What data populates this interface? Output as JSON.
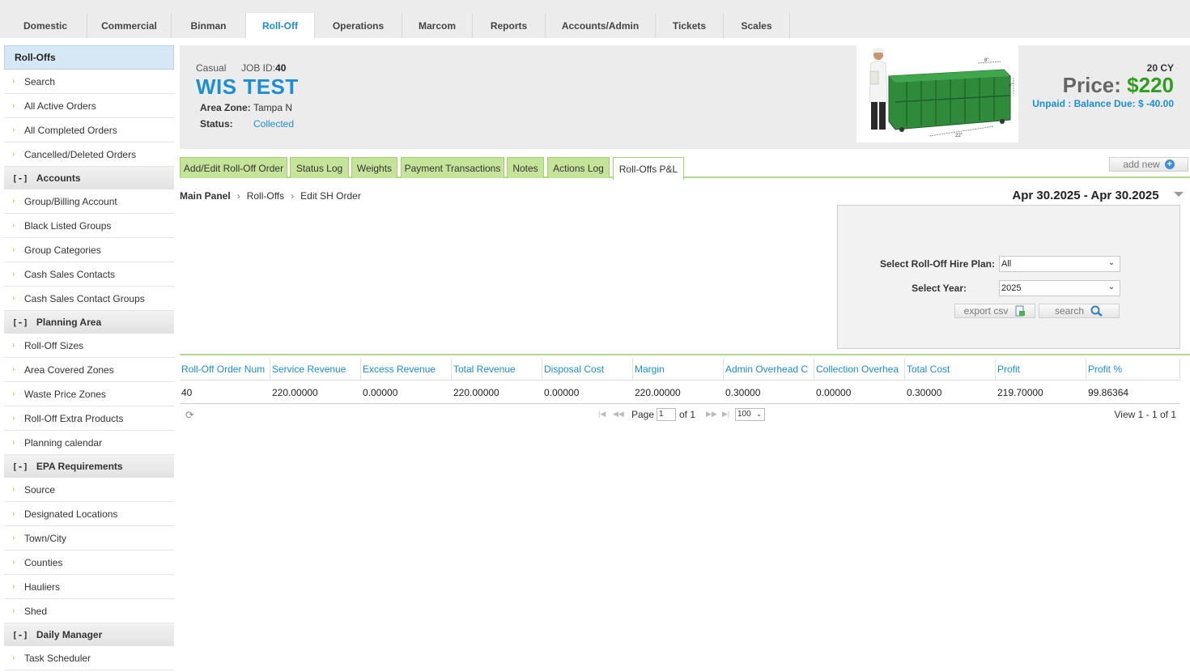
{
  "topnav": {
    "tabs": [
      {
        "label": "Domestic"
      },
      {
        "label": "Commercial"
      },
      {
        "label": "Binman"
      },
      {
        "label": "Roll-Off"
      },
      {
        "label": "Operations"
      },
      {
        "label": "Marcom"
      },
      {
        "label": "Reports"
      },
      {
        "label": "Accounts/Admin"
      },
      {
        "label": "Tickets"
      },
      {
        "label": "Scales"
      }
    ],
    "active": "Roll-Off"
  },
  "sidebar": {
    "title": "Roll-Offs",
    "items_top": [
      "Search",
      "All Active Orders",
      "All Completed Orders",
      "Cancelled/Deleted Orders"
    ],
    "sections": [
      {
        "toggle": "[-]",
        "label": "Accounts",
        "items": [
          "Group/Billing Account",
          "Black Listed Groups",
          "Group Categories",
          "Cash Sales Contacts",
          "Cash Sales Contact Groups"
        ]
      },
      {
        "toggle": "[-]",
        "label": "Planning Area",
        "items": [
          "Roll-Off Sizes",
          "Area Covered Zones",
          "Waste Price Zones",
          "Roll-Off Extra Products",
          "Planning calendar"
        ]
      },
      {
        "toggle": "[-]",
        "label": "EPA Requirements",
        "items": [
          "Source",
          "Designated Locations",
          "Town/City",
          "Counties",
          "Hauliers",
          "Shed"
        ]
      },
      {
        "toggle": "[-]",
        "label": "Daily Manager",
        "items": [
          "Task Scheduler"
        ]
      }
    ]
  },
  "job": {
    "type": "Casual",
    "id_label": "JOB ID:",
    "id": "40",
    "name": "WIS TEST",
    "area_zone_label": "Area Zone:",
    "area_zone": "Tampa N",
    "status_label": "Status:",
    "status": "Collected",
    "size": "20 CY",
    "price_label": "Price: ",
    "price": "$220",
    "balance": "Unpaid : Balance Due: $ -40.00",
    "dimensions": {
      "height": "8\"",
      "depth": "4\"",
      "length": "22\""
    }
  },
  "panel_tabs": {
    "tabs": [
      "Add/Edit Roll-Off Order",
      "Status Log",
      "Weights",
      "Payment Transactions",
      "Notes",
      "Actions Log",
      "Roll-Offs P&L"
    ],
    "active": "Roll-Offs P&L",
    "add_new": "add new"
  },
  "breadcrumb": [
    "Main Panel",
    "Roll-Offs",
    "Edit SH Order"
  ],
  "filter": {
    "date_range": "Apr 30.2025 - Apr 30.2025",
    "plan_label": "Select Roll-Off Hire Plan:",
    "plan_value": "All",
    "year_label": "Select Year:",
    "year_value": "2025",
    "export_label": "export csv",
    "search_label": "search"
  },
  "grid": {
    "columns": [
      "Roll-Off Order Num",
      "Service Revenue",
      "Excess Revenue",
      "Total Revenue",
      "Disposal Cost",
      "Margin",
      "Admin Overhead C",
      "Collection Overhea",
      "Total Cost",
      "Profit",
      "Profit %"
    ],
    "rows": [
      [
        "40",
        "220.00000",
        "0.00000",
        "220.00000",
        "0.00000",
        "220.00000",
        "0.30000",
        "0.00000",
        "0.30000",
        "219.70000",
        "99.86364"
      ]
    ]
  },
  "pager": {
    "page_label": "Page",
    "page": "1",
    "of_label": "of 1",
    "rows_per_page": "100",
    "view_label": "View 1 - 1 of 1"
  },
  "colors": {
    "accent": "#1a8fd6",
    "price_green": "#2e9e1f",
    "tab_green": "#c6e39a",
    "sidebar_title": "#d6e8f6"
  }
}
